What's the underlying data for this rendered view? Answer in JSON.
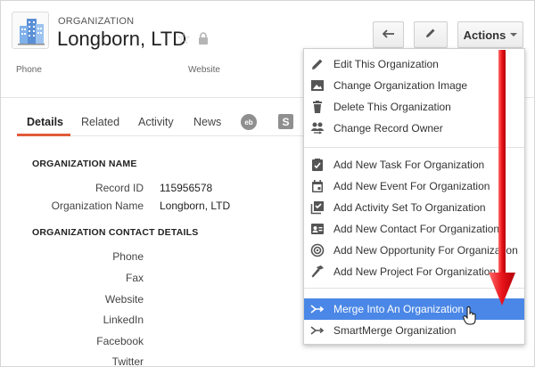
{
  "header": {
    "kicker": "ORGANIZATION",
    "title": "Longborn, LTD",
    "icons": {
      "org": "building-icon",
      "star": "star-outline-icon",
      "lock": "lock-icon"
    }
  },
  "toolbar": {
    "back_icon": "reply-arrow-icon",
    "edit_icon": "pencil-icon",
    "actions_label": "Actions"
  },
  "contact_strip": {
    "phone_label": "Phone",
    "website_label": "Website"
  },
  "tabs": [
    {
      "label": "Details",
      "active": true
    },
    {
      "label": "Related"
    },
    {
      "label": "Activity"
    },
    {
      "label": "News"
    },
    {
      "icon": "gmail-circle-icon",
      "text": "eb"
    },
    {
      "icon": "s-square-icon",
      "text": "S"
    }
  ],
  "sections": {
    "name": {
      "title": "ORGANIZATION NAME",
      "fields": [
        {
          "label": "Record ID",
          "value": "115956578"
        },
        {
          "label": "Organization Name",
          "value": "Longborn, LTD"
        }
      ]
    },
    "contact": {
      "title": "ORGANIZATION CONTACT DETAILS",
      "fields": [
        {
          "label": "Phone"
        },
        {
          "label": "Fax"
        },
        {
          "label": "Website"
        },
        {
          "label": "LinkedIn"
        },
        {
          "label": "Facebook"
        },
        {
          "label": "Twitter"
        }
      ]
    }
  },
  "actions_menu": {
    "items": [
      {
        "label": "Edit This Organization",
        "icon": "pencil-icon"
      },
      {
        "label": "Change Organization Image",
        "icon": "image-icon"
      },
      {
        "label": "Delete This Organization",
        "icon": "trash-icon"
      },
      {
        "label": "Change Record Owner",
        "icon": "people-swap-icon"
      },
      {
        "label": "Add New Task For Organization",
        "icon": "task-clipboard-icon"
      },
      {
        "label": "Add New Event For Organization",
        "icon": "calendar-icon"
      },
      {
        "label": "Add Activity Set To Organization",
        "icon": "checklist-icon"
      },
      {
        "label": "Add New Contact For Organization",
        "icon": "contact-card-icon"
      },
      {
        "label": "Add New Opportunity For Organization",
        "icon": "target-icon"
      },
      {
        "label": "Add New Project For Organization",
        "icon": "hammer-icon"
      },
      {
        "label": "Merge Into An Organization",
        "icon": "merge-icon",
        "highlighted": true
      },
      {
        "label": "SmartMerge Organization",
        "icon": "merge-icon"
      }
    ]
  },
  "colors": {
    "accent_tab": "#e25b3a",
    "menu_highlight": "#4a87e6",
    "annotation_arrow": "#e8141a"
  }
}
